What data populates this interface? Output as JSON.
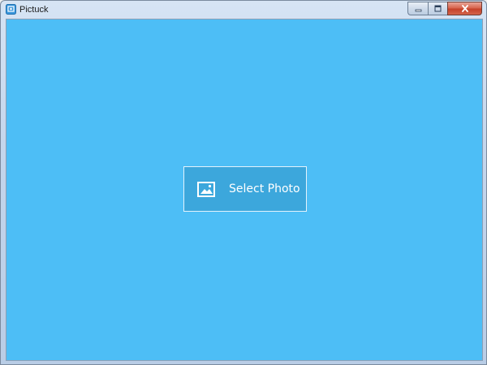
{
  "window": {
    "title": "Pictuck",
    "app_icon": "pictuck-app-icon",
    "controls": {
      "minimize_icon": "minimize-icon",
      "maximize_icon": "maximize-icon",
      "close_icon": "close-icon"
    }
  },
  "main": {
    "background_color": "#4dbef6",
    "select_button": {
      "label": "Select Photo",
      "icon": "image-icon",
      "background_color": "#3ca7dc"
    }
  }
}
